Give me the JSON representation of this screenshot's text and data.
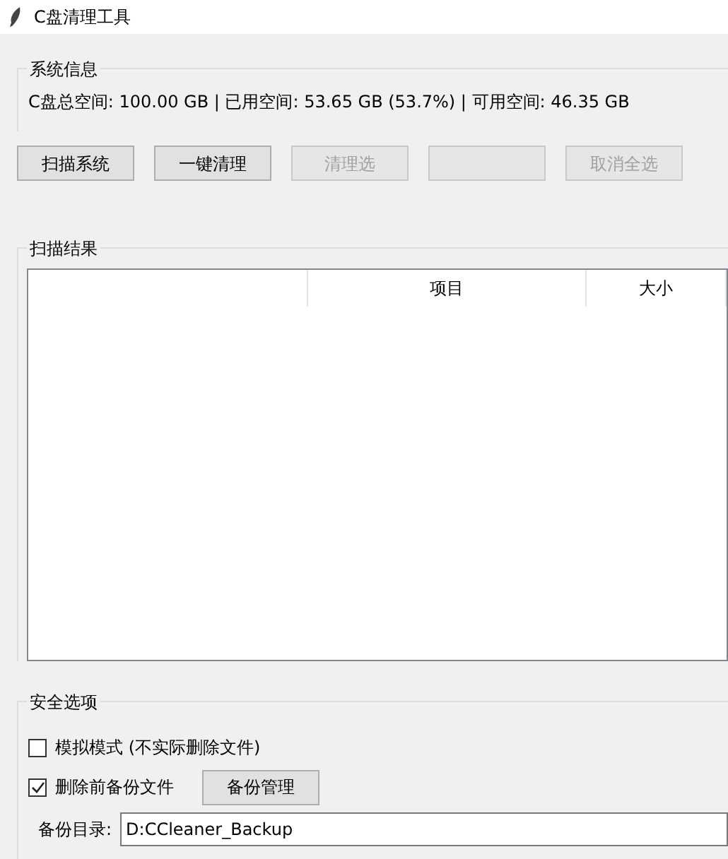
{
  "window": {
    "title": "C盘清理工具"
  },
  "system_info": {
    "title": "系统信息",
    "text": "C盘总空间: 100.00 GB | 已用空间: 53.65 GB (53.7%) | 可用空间: 46.35 GB"
  },
  "buttons": [
    {
      "label": "扫描系统",
      "disabled": false
    },
    {
      "label": "一键清理",
      "disabled": false
    },
    {
      "label": "清理选",
      "disabled": true
    },
    {
      "disabled": true
    },
    {
      "label": "取消全选",
      "disabled": true
    }
  ],
  "scan_results": {
    "title": "扫描结果",
    "columns": [
      {},
      {
        "label": "项目"
      },
      {
        "label": "大小"
      }
    ]
  },
  "safety": {
    "title": "安全选项",
    "options": [
      {
        "label": "模拟模式 (不实际删除文件)",
        "checked": false
      },
      {
        "label": "删除前备份文件",
        "checked": true
      }
    ],
    "backup_button": "备份管理",
    "backup_dir": {
      "label": "备份目录:",
      "value": "D:CCleaner_Backup"
    }
  }
}
